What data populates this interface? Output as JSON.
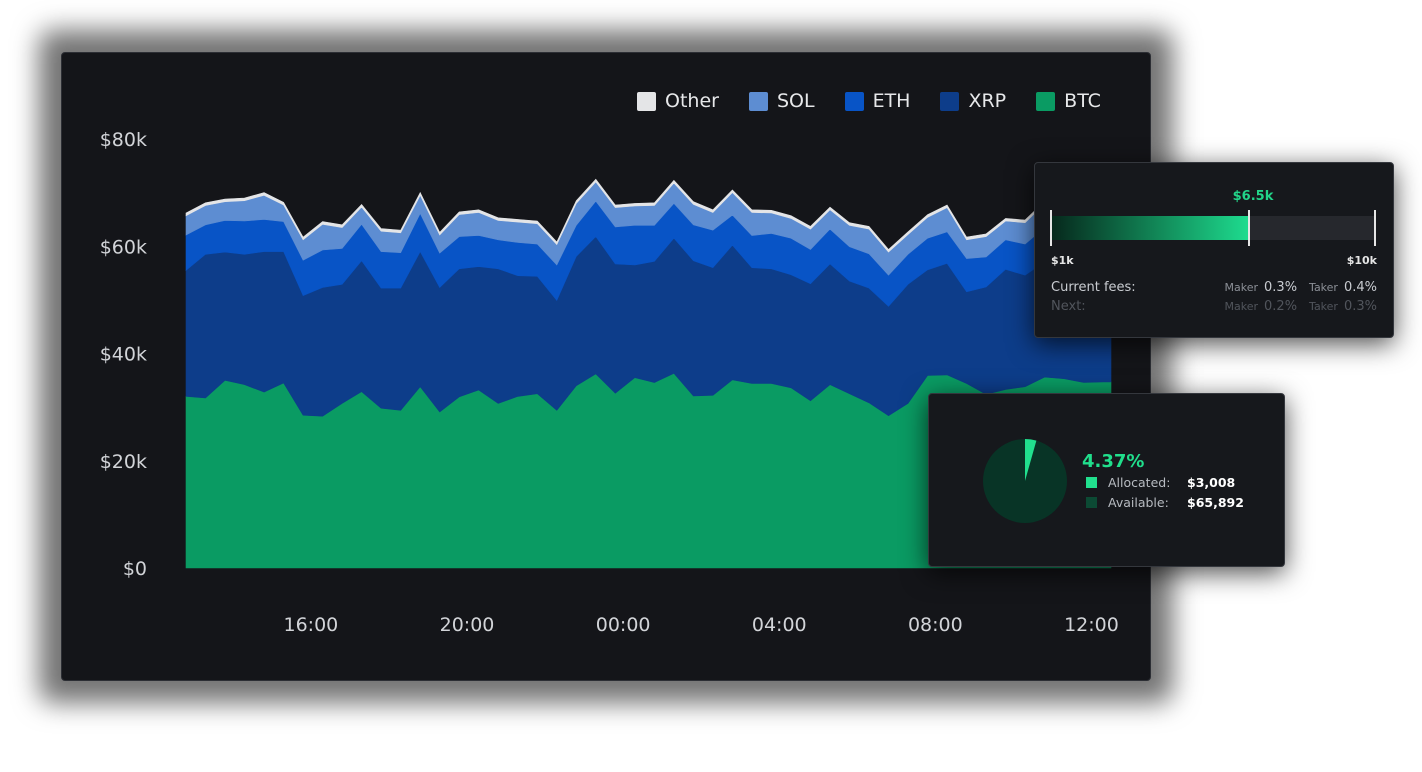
{
  "chart_data": {
    "type": "area",
    "stacked": true,
    "x_ticks": [
      "16:00",
      "20:00",
      "00:00",
      "04:00",
      "08:00",
      "12:00"
    ],
    "x_tick_positions": [
      3.7,
      7.7,
      11.7,
      15.7,
      19.7,
      23.7
    ],
    "x_range": [
      0.5,
      24.2
    ],
    "ylim": [
      0,
      80000
    ],
    "y_ticks": [
      {
        "value": 0,
        "label": "$0"
      },
      {
        "value": 20000,
        "label": "$20k"
      },
      {
        "value": 40000,
        "label": "$40k"
      },
      {
        "value": 60000,
        "label": "$60k"
      },
      {
        "value": 80000,
        "label": "$80k"
      }
    ],
    "x": [
      0.5,
      1,
      1.5,
      2,
      2.5,
      3,
      3.5,
      4,
      4.5,
      5,
      5.5,
      6,
      6.5,
      7,
      7.5,
      8,
      8.5,
      9,
      9.5,
      10,
      10.5,
      11,
      11.5,
      12,
      12.5,
      13,
      13.5,
      14,
      14.5,
      15,
      15.5,
      16,
      16.5,
      17,
      17.5,
      18,
      18.5,
      19,
      19.5,
      20,
      20.5,
      21,
      21.5,
      22,
      22.5,
      23,
      23.5,
      24,
      24.2
    ],
    "series": [
      {
        "name": "BTC",
        "color": "#0a9b63",
        "values": [
          32000,
          31700,
          35000,
          34200,
          32800,
          34500,
          28500,
          28300,
          30700,
          32900,
          29800,
          29400,
          33800,
          29100,
          31900,
          33200,
          30700,
          32000,
          32500,
          29400,
          34000,
          36200,
          32600,
          35500,
          34600,
          36300,
          32100,
          32200,
          35100,
          34400,
          34400,
          33600,
          31200,
          34200,
          32500,
          30800,
          28400,
          30700,
          35900,
          36000,
          34400,
          32400,
          33300,
          33800,
          35600,
          35300,
          34600,
          34700,
          34700
        ]
      },
      {
        "name": "XRP",
        "color": "#0d3d8a",
        "values": [
          23500,
          26800,
          23900,
          24300,
          26200,
          24500,
          22300,
          24000,
          22200,
          24400,
          22400,
          22800,
          25200,
          23200,
          23900,
          23000,
          25100,
          22500,
          21900,
          20500,
          24100,
          25600,
          24100,
          21000,
          22600,
          25200,
          25200,
          23800,
          25100,
          21600,
          21400,
          21100,
          21800,
          22500,
          21000,
          21400,
          20400,
          22200,
          19700,
          20800,
          17100,
          20000,
          22400,
          20800,
          21500,
          24400,
          24300,
          22800,
          22800
        ]
      },
      {
        "name": "ETH",
        "color": "#0854c6",
        "values": [
          6600,
          5500,
          5900,
          6200,
          6000,
          5600,
          6600,
          7000,
          6700,
          6800,
          6800,
          6600,
          7100,
          6400,
          6000,
          5800,
          5400,
          6200,
          6000,
          6600,
          5800,
          6600,
          6900,
          7400,
          6700,
          6500,
          6700,
          7000,
          5600,
          6000,
          6600,
          6800,
          6400,
          6500,
          6400,
          6400,
          5800,
          5600,
          5900,
          5900,
          6200,
          5600,
          5500,
          5800,
          6400,
          5900,
          5800,
          5700,
          5700
        ]
      },
      {
        "name": "SOL",
        "color": "#5d8dd2",
        "values": [
          3600,
          3600,
          3500,
          3800,
          4500,
          3100,
          3800,
          4800,
          3900,
          3200,
          3800,
          3700,
          3400,
          3400,
          4100,
          4300,
          3600,
          3800,
          3800,
          3800,
          4100,
          3600,
          3600,
          3600,
          3700,
          3800,
          3800,
          3300,
          4200,
          4300,
          3800,
          3700,
          3800,
          3600,
          4000,
          4600,
          4300,
          3700,
          3900,
          4500,
          3500,
          3800,
          3500,
          4000,
          4400,
          3800,
          3700,
          3800,
          3800
        ]
      },
      {
        "name": "Other",
        "color": "#e4e5e7",
        "values": [
          500,
          500,
          500,
          500,
          500,
          500,
          500,
          500,
          500,
          500,
          500,
          500,
          500,
          500,
          500,
          500,
          500,
          500,
          500,
          500,
          500,
          500,
          500,
          500,
          500,
          500,
          500,
          500,
          500,
          500,
          500,
          500,
          500,
          500,
          500,
          500,
          500,
          500,
          500,
          500,
          500,
          500,
          500,
          500,
          500,
          500,
          500,
          500,
          500
        ]
      }
    ],
    "legend_order": [
      "Other",
      "SOL",
      "ETH",
      "XRP",
      "BTC"
    ],
    "legend_placement": "top-right",
    "grid": false
  },
  "fee_tier": {
    "current_label": "$6.5k",
    "progress": 0.61,
    "min_label": "$1k",
    "max_label": "$10k",
    "current_fees_label": "Current fees:",
    "next_label": "Next:",
    "maker_label": "Maker",
    "taker_label": "Taker",
    "current_maker": "0.3%",
    "current_taker": "0.4%",
    "next_maker": "0.2%",
    "next_taker": "0.3%"
  },
  "allocation": {
    "percent_label": "4.37%",
    "fraction": 0.0437,
    "allocated_label": "Allocated:",
    "allocated_value": "$3,008",
    "available_label": "Available:",
    "available_value": "$65,892",
    "allocated_color": "#21e08e",
    "available_color": "#083426"
  }
}
